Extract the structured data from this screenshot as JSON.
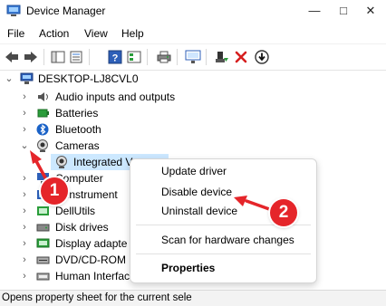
{
  "window": {
    "title": "Device Manager",
    "minimize": "—",
    "maximize": "□",
    "close": "✕"
  },
  "menu": [
    "File",
    "Action",
    "View",
    "Help"
  ],
  "tree": {
    "root": "DESKTOP-LJ8CVL0",
    "items": [
      {
        "label": "Audio inputs and outputs",
        "icon": "speaker-icon"
      },
      {
        "label": "Batteries",
        "icon": "battery-icon"
      },
      {
        "label": "Bluetooth",
        "icon": "bluetooth-icon"
      },
      {
        "label": "Cameras",
        "icon": "camera-icon",
        "expanded": true
      },
      {
        "label": "Integrated V",
        "icon": "camera-icon",
        "child": true,
        "selected": true
      },
      {
        "label": "Computer",
        "icon": "computer-icon"
      },
      {
        "label": "ellInstrument",
        "icon": "instrument-icon"
      },
      {
        "label": "DellUtils",
        "icon": "device-icon"
      },
      {
        "label": "Disk drives",
        "icon": "disk-icon"
      },
      {
        "label": "Display adapte",
        "icon": "display-icon"
      },
      {
        "label": "DVD/CD-ROM",
        "icon": "dvd-icon"
      },
      {
        "label": "Human Interface Devices",
        "icon": "hid-icon"
      }
    ]
  },
  "context_menu": {
    "items": [
      "Update driver",
      "Disable device",
      "Uninstall device"
    ],
    "scan": "Scan for hardware changes",
    "properties": "Properties"
  },
  "annotations": {
    "badge1": "1",
    "badge2": "2",
    "accent": "#e5252a"
  },
  "status": "Opens property sheet for the current sele"
}
